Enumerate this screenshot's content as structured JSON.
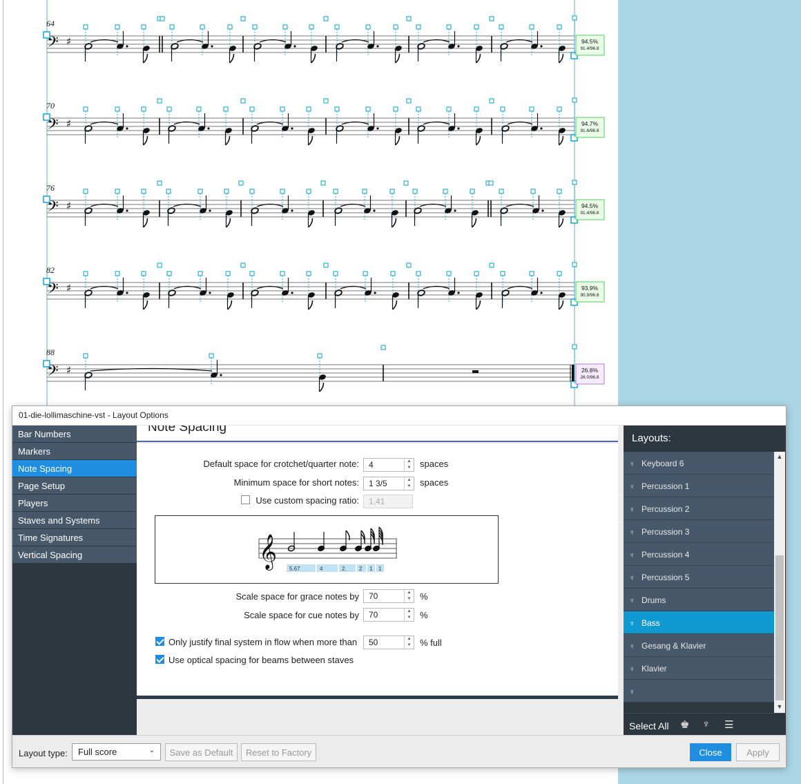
{
  "score": {
    "systems": [
      {
        "bar": "64",
        "pct": "94.5%",
        "ratio": "91.4/96.8",
        "box_color": "#53d05a",
        "box_fill": "#eafbe8"
      },
      {
        "bar": "70",
        "pct": "94.7%",
        "ratio": "91.6/96.8",
        "box_color": "#53d05a",
        "box_fill": "#eafbe8"
      },
      {
        "bar": "76",
        "pct": "94.5%",
        "ratio": "91.4/96.8",
        "box_color": "#53d05a",
        "box_fill": "#eafbe8"
      },
      {
        "bar": "82",
        "pct": "93.9%",
        "ratio": "90.9/96.8",
        "box_color": "#53d05a",
        "box_fill": "#eafbe8"
      },
      {
        "bar": "88",
        "pct": "26.8%",
        "ratio": "26.0/96.8",
        "box_color": "#b57ad6",
        "box_fill": "#f5ecfb"
      }
    ],
    "handle_color": "#00a0d8"
  },
  "dialog": {
    "title": "01-die-lollimaschine-vst - Layout Options",
    "nav": [
      {
        "label": "Bar Numbers",
        "active": false
      },
      {
        "label": "Markers",
        "active": false
      },
      {
        "label": "Note Spacing",
        "active": true
      },
      {
        "label": "Page Setup",
        "active": false
      },
      {
        "label": "Players",
        "active": false
      },
      {
        "label": "Staves and Systems",
        "active": false
      },
      {
        "label": "Time Signatures",
        "active": false
      },
      {
        "label": "Vertical Spacing",
        "active": false
      }
    ],
    "section_title": "Note Spacing",
    "fields": {
      "crotchet_label": "Default space for crotchet/quarter note:",
      "crotchet_value": "4",
      "crotchet_unit": "spaces",
      "short_label": "Minimum space for short notes:",
      "short_value": "1 3/5",
      "short_unit": "spaces",
      "custom_ratio_label": "Use custom spacing ratio:",
      "custom_ratio_value": "1,41",
      "custom_ratio_checked": false,
      "grace_label": "Scale space for grace notes by",
      "grace_value": "70",
      "grace_unit": "%",
      "cue_label": "Scale space for cue notes by",
      "cue_value": "70",
      "cue_unit": "%",
      "justify_label": "Only justify final system in flow when more than",
      "justify_value": "50",
      "justify_unit": "% full",
      "justify_checked": true,
      "optical_label": "Use optical spacing for beams between staves",
      "optical_checked": true
    },
    "preview_numbers": [
      "5.67",
      "4",
      "2.",
      "2",
      "1",
      "1"
    ],
    "layouts_header": "Layouts:",
    "layouts": [
      {
        "label": "Keyboard 6",
        "active": false
      },
      {
        "label": "Percussion 1",
        "active": false
      },
      {
        "label": "Percussion 2",
        "active": false
      },
      {
        "label": "Percussion 3",
        "active": false
      },
      {
        "label": "Percussion 4",
        "active": false
      },
      {
        "label": "Percussion 5",
        "active": false
      },
      {
        "label": "Drums",
        "active": false
      },
      {
        "label": "Bass",
        "active": true
      },
      {
        "label": "Gesang & Klavier",
        "active": false
      },
      {
        "label": "Klavier",
        "active": false
      },
      {
        "label": "",
        "active": false
      }
    ],
    "select_all": "Select All",
    "layout_type_label": "Layout type:",
    "layout_type_value": "Full score",
    "buttons": {
      "save_default": "Save as Default",
      "reset_factory": "Reset to Factory",
      "close": "Close",
      "apply": "Apply"
    }
  }
}
